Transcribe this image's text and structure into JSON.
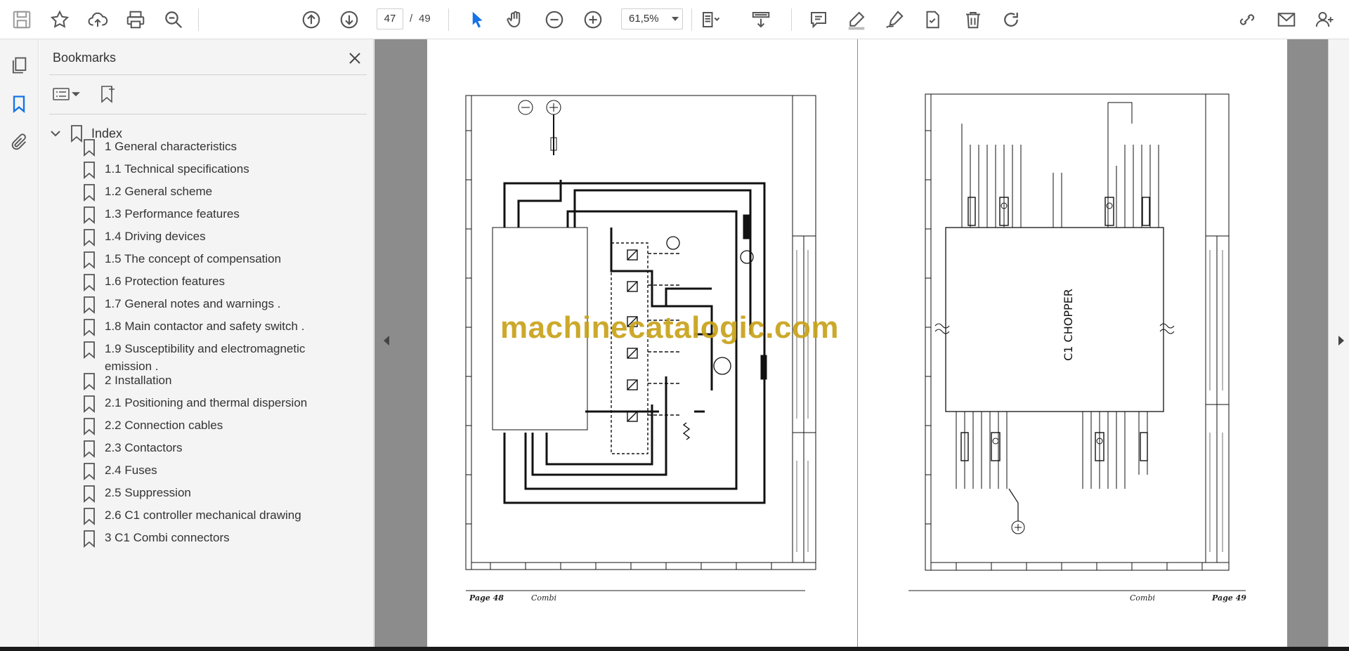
{
  "toolbar": {
    "current_page": "47",
    "page_separator": "/",
    "total_pages": "49",
    "zoom": "61,5%"
  },
  "bookmarks": {
    "title": "Bookmarks",
    "root": "Index",
    "items": [
      {
        "label": "1 General characteristics"
      },
      {
        "label": "1.1 Technical specifications"
      },
      {
        "label": "1.2 General scheme"
      },
      {
        "label": "1.3 Performance features"
      },
      {
        "label": "1.4 Driving devices"
      },
      {
        "label": "1.5 The concept of compensation"
      },
      {
        "label": "1.6 Protection features"
      },
      {
        "label": "1.7 General notes and warnings        ."
      },
      {
        "label": "1.8 Main contactor and safety switch       ."
      },
      {
        "label": "1.9 Susceptibility and electromagnetic emission        ."
      },
      {
        "label": "2 Installation"
      },
      {
        "label": "2.1 Positioning and thermal dispersion"
      },
      {
        "label": "2.2 Connection cables"
      },
      {
        "label": "2.3 Contactors"
      },
      {
        "label": "2.4 Fuses"
      },
      {
        "label": "2.5 Suppression"
      },
      {
        "label": "2.6 C1 controller mechanical drawing"
      },
      {
        "label": "3 C1 Combi connectors"
      }
    ]
  },
  "document": {
    "left_page": {
      "page_label": "Page 48",
      "doc_name": "Combi"
    },
    "right_page": {
      "page_label": "Page 49",
      "doc_name": "Combi",
      "chopper_label": "C1 CHOPPER"
    },
    "watermark": "machinecatalogic.com"
  },
  "colors": {
    "accent": "#1473e6",
    "watermark": "#c8a21a",
    "doc_background": "#8c8c8c"
  }
}
